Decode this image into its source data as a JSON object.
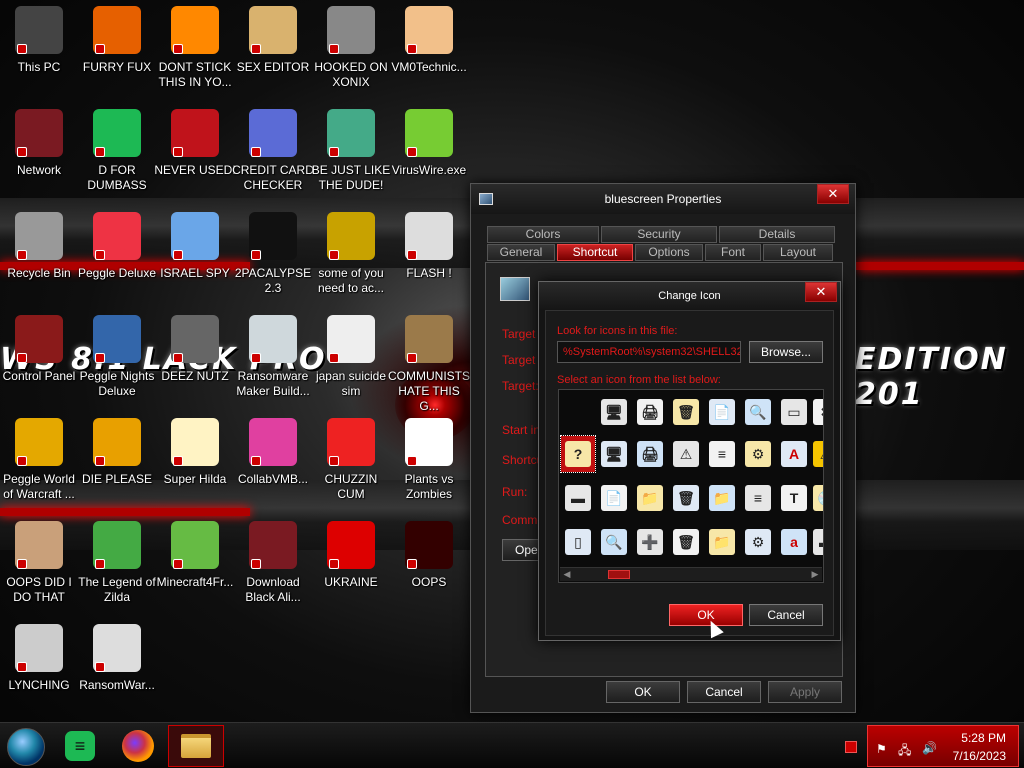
{
  "desktop": {
    "wallpaper_text_left": "WS 8.1 LACK PRO",
    "wallpaper_text_right": "EDITION 201",
    "icons": [
      {
        "label": "This PC",
        "icon": "computer-icon",
        "color": "#444"
      },
      {
        "label": "FURRY FUX",
        "icon": "firefox-icon",
        "color": "#e66000"
      },
      {
        "label": "DONT STICK THIS IN YO...",
        "icon": "vlc-icon",
        "color": "#f80"
      },
      {
        "label": "SEX EDITOR",
        "icon": "hex-editor-icon",
        "color": "#d9b26e"
      },
      {
        "label": "HOOKED ON XONIX",
        "icon": "xonix-icon",
        "color": "#888"
      },
      {
        "label": "VM0Technic...",
        "icon": "doctor-icon",
        "color": "#f2c08a"
      },
      {
        "label": "Network",
        "icon": "alien-network-icon",
        "color": "#7a1a22"
      },
      {
        "label": "D FOR DUMBASS",
        "icon": "spotify-icon",
        "color": "#1db954"
      },
      {
        "label": "NEVER USED!",
        "icon": "devcpp-icon",
        "color": "#c0131b"
      },
      {
        "label": "CREDIT CARD CHECKER",
        "icon": "credit-card-icon",
        "color": "#5b6bd6"
      },
      {
        "label": "BE JUST LIKE THE DUDE!",
        "icon": "santa-icon",
        "color": "#4a8"
      },
      {
        "label": "VirusWire.exe",
        "icon": "limewire-icon",
        "color": "#7c3"
      },
      {
        "label": "Recycle Bin",
        "icon": "recycle-bin-icon",
        "color": "#999"
      },
      {
        "label": "Peggle Deluxe",
        "icon": "peggle-icon",
        "color": "#e34"
      },
      {
        "label": "ISRAEL SPY",
        "icon": "spy-icon",
        "color": "#6aa6e8"
      },
      {
        "label": "2PACALYPSE 2.3",
        "icon": "cmd-icon",
        "color": "#111"
      },
      {
        "label": "some of you need to ac...",
        "icon": "dog-icon",
        "color": "#c8a200"
      },
      {
        "label": "FLASH !",
        "icon": "flash-icon",
        "color": "#ddd"
      },
      {
        "label": "Control Panel",
        "icon": "control-panel-icon",
        "color": "#8a1a1a"
      },
      {
        "label": "Peggle Nights Deluxe",
        "icon": "peggle-nights-icon",
        "color": "#36a"
      },
      {
        "label": "DEEZ NUTZ",
        "icon": "stack-icon",
        "color": "#666"
      },
      {
        "label": "Ransomware Maker Build...",
        "icon": "ransomware-icon",
        "color": "#cfd8dc"
      },
      {
        "label": "japan suicide sim",
        "icon": "document-icon",
        "color": "#eee"
      },
      {
        "label": "COMMUNISTS HATE THIS G...",
        "icon": "money-bag-icon",
        "color": "#9b7a4a"
      },
      {
        "label": "Peggle World of Warcraft ...",
        "icon": "peggle-wow-icon",
        "color": "#e4a800"
      },
      {
        "label": "DIE PLEASE",
        "icon": "de-icon",
        "color": "#e8a000"
      },
      {
        "label": "Super Hilda",
        "icon": "hilda-icon",
        "color": "#fff3c4"
      },
      {
        "label": "CollabVMB...",
        "icon": "collabvm-icon",
        "color": "#e040a0"
      },
      {
        "label": "CHUZZIN CUM",
        "icon": "chuzzle-icon",
        "color": "#e22"
      },
      {
        "label": "Plants vs Zombies",
        "icon": "pvz-icon",
        "color": "#fff"
      },
      {
        "label": "OOPS DID I DO THAT",
        "icon": "portrait-icon",
        "color": "#c9a07a"
      },
      {
        "label": "The Legend of Zilda",
        "icon": "zelda-icon",
        "color": "#4a4"
      },
      {
        "label": "Minecraft4Fr...",
        "icon": "minecraft-icon",
        "color": "#6b4"
      },
      {
        "label": "Download Black Ali...",
        "icon": "alien-icon",
        "color": "#7a1a22"
      },
      {
        "label": "UKRAINE",
        "icon": "radiation-icon",
        "color": "#d00"
      },
      {
        "label": "OOPS",
        "icon": "alien-book-icon",
        "color": "#300"
      },
      {
        "label": "LYNCHING",
        "icon": "lynch-icon",
        "color": "#ccc"
      },
      {
        "label": "RansomWar...",
        "icon": "skull-icon",
        "color": "#ddd"
      }
    ]
  },
  "properties_window": {
    "title": "bluescreen Properties",
    "close_label": "✕",
    "tabs_top": [
      "Colors",
      "Security",
      "Details"
    ],
    "tabs_bottom": [
      "General",
      "Shortcut",
      "Options",
      "Font",
      "Layout"
    ],
    "active_tab": "Shortcut",
    "side_labels": [
      "Target ty",
      "Target lo",
      "Target:",
      "Start in:",
      "Shortcut",
      "Run:",
      "Commen"
    ],
    "open_button": "Open",
    "ok_label": "OK",
    "cancel_label": "Cancel",
    "apply_label": "Apply"
  },
  "change_icon_dialog": {
    "title": "Change Icon",
    "close_label": "✕",
    "look_for_label": "Look for icons in this file:",
    "file_path": "%SystemRoot%\\system32\\SHELL32.dll",
    "browse_label": "Browse...",
    "select_label": "Select an icon from the list below:",
    "ok_label": "OK",
    "cancel_label": "Cancel",
    "icons": [
      {
        "name": "blank-icon",
        "glyph": ""
      },
      {
        "name": "computer-network-icon",
        "glyph": "🖥"
      },
      {
        "name": "printer-icon",
        "glyph": "🖨"
      },
      {
        "name": "recycle-bin-full-icon",
        "glyph": "🗑"
      },
      {
        "name": "document-arrow-icon",
        "glyph": "📄"
      },
      {
        "name": "search-document-icon",
        "glyph": "🔍"
      },
      {
        "name": "window-icon",
        "glyph": "▭"
      },
      {
        "name": "error-icon",
        "glyph": "✖"
      },
      {
        "name": "unknown-drive-icon",
        "glyph": "?"
      },
      {
        "name": "monitor-icon",
        "glyph": "🖥"
      },
      {
        "name": "printer-network-icon",
        "glyph": "🖨"
      },
      {
        "name": "warning-document-icon",
        "glyph": "⚠"
      },
      {
        "name": "text-document-icon",
        "glyph": "≡"
      },
      {
        "name": "gear-document-icon",
        "glyph": "⚙"
      },
      {
        "name": "font-a-icon",
        "glyph": "A"
      },
      {
        "name": "warning-icon",
        "glyph": "⚠"
      },
      {
        "name": "drive-partial-icon",
        "glyph": "▬"
      },
      {
        "name": "documents-icon",
        "glyph": "📄"
      },
      {
        "name": "folder-printer-icon",
        "glyph": "📁"
      },
      {
        "name": "recycle-bin-icon",
        "glyph": "🗑"
      },
      {
        "name": "folder-warning-icon",
        "glyph": "📁"
      },
      {
        "name": "lined-document-icon",
        "glyph": "≡"
      },
      {
        "name": "font-t-icon",
        "glyph": "T"
      },
      {
        "name": "cd-drive-icon",
        "glyph": "💿"
      },
      {
        "name": "partial-icon-2",
        "glyph": "▯"
      },
      {
        "name": "magnifier-document-icon",
        "glyph": "🔍"
      },
      {
        "name": "add-printer-icon",
        "glyph": "➕"
      },
      {
        "name": "recycle-bin-empty-icon",
        "glyph": "🗑"
      },
      {
        "name": "folder-network-icon",
        "glyph": "📁"
      },
      {
        "name": "settings-document-icon",
        "glyph": "⚙"
      },
      {
        "name": "font-italic-a-icon",
        "glyph": "a"
      },
      {
        "name": "drive-icon",
        "glyph": "▬"
      },
      {
        "name": "partial-icon-3",
        "glyph": "✔"
      }
    ]
  },
  "taskbar": {
    "items": [
      {
        "name": "start-button",
        "icon": "windows-orb-icon"
      },
      {
        "name": "taskbar-spotify",
        "icon": "spotify-icon"
      },
      {
        "name": "taskbar-firefox",
        "icon": "firefox-icon"
      },
      {
        "name": "taskbar-explorer",
        "icon": "folder-icon"
      }
    ],
    "time": "5:28 PM",
    "date": "7/16/2023"
  }
}
